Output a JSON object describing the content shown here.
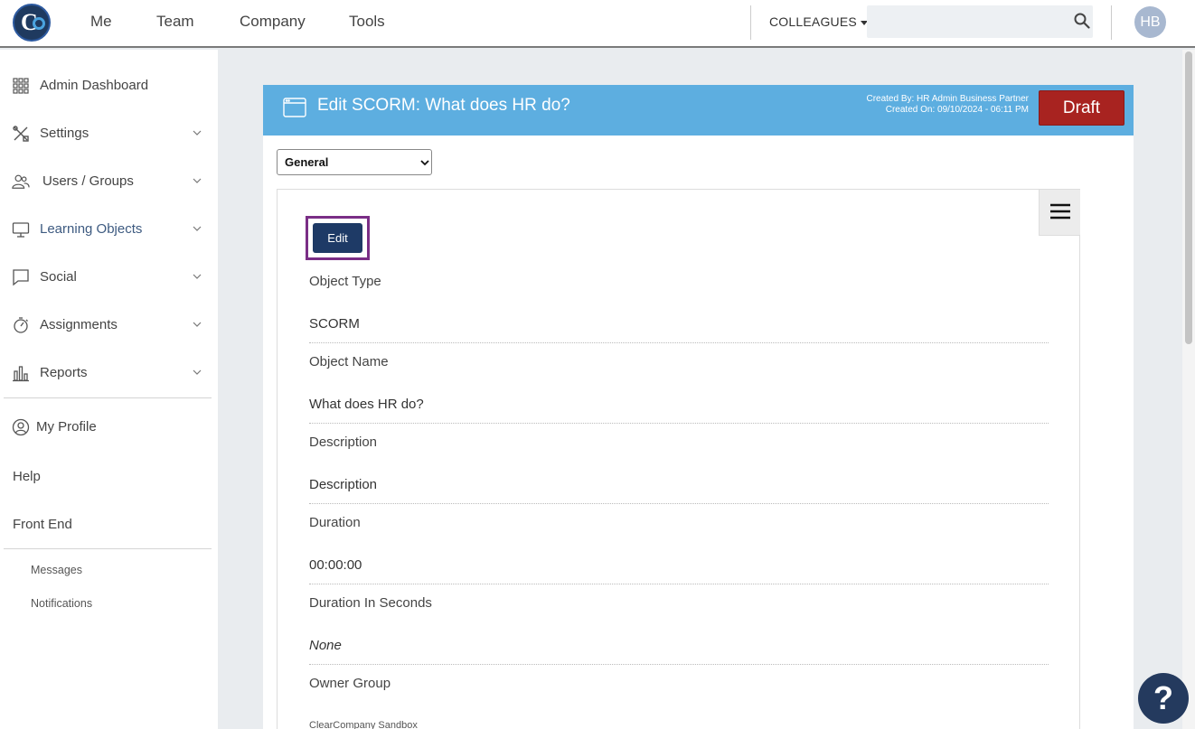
{
  "nav": {
    "items": [
      "Me",
      "Team",
      "Company",
      "Tools"
    ],
    "colleagues_label": "COLLEAGUES",
    "search_value": "",
    "avatar_initials": "HB"
  },
  "sidebar": {
    "items": [
      {
        "label": "Admin Dashboard",
        "icon": "grid-icon",
        "chevron": false
      },
      {
        "label": "Settings",
        "icon": "tools-icon",
        "chevron": true
      },
      {
        "label": "Users / Groups",
        "icon": "users-icon",
        "chevron": true
      },
      {
        "label": "Learning Objects",
        "icon": "monitor-icon",
        "chevron": true,
        "active": true
      },
      {
        "label": "Social",
        "icon": "chat-icon",
        "chevron": true
      },
      {
        "label": "Assignments",
        "icon": "stopwatch-icon",
        "chevron": true
      },
      {
        "label": "Reports",
        "icon": "bar-chart-icon",
        "chevron": true
      }
    ],
    "secondary": [
      "My Profile",
      "Help",
      "Front End"
    ],
    "small": [
      "Messages",
      "Notifications"
    ]
  },
  "panel": {
    "title": "Edit SCORM: What does HR do?",
    "created_by": "Created By: HR Admin Business Partner",
    "created_on": "Created On: 09/10/2024 - 06:11 PM",
    "status": "Draft",
    "section_select": "General",
    "edit_label": "Edit",
    "fields": [
      {
        "label": "Object Type",
        "value": "SCORM"
      },
      {
        "label": "Object Name",
        "value": "What does HR do?"
      },
      {
        "label": "Description",
        "value": "Description"
      },
      {
        "label": "Duration",
        "value": "00:00:00"
      },
      {
        "label": "Duration In Seconds",
        "value": "None"
      },
      {
        "label": "Owner Group",
        "value": "ClearCompany Sandbox"
      }
    ]
  },
  "help_label": "?",
  "colors": {
    "header_blue": "#5daee0",
    "draft_red": "#a82320",
    "edit_navy": "#1e3a66",
    "highlight_purple": "#7a2e86",
    "help_navy": "#243a5e"
  }
}
